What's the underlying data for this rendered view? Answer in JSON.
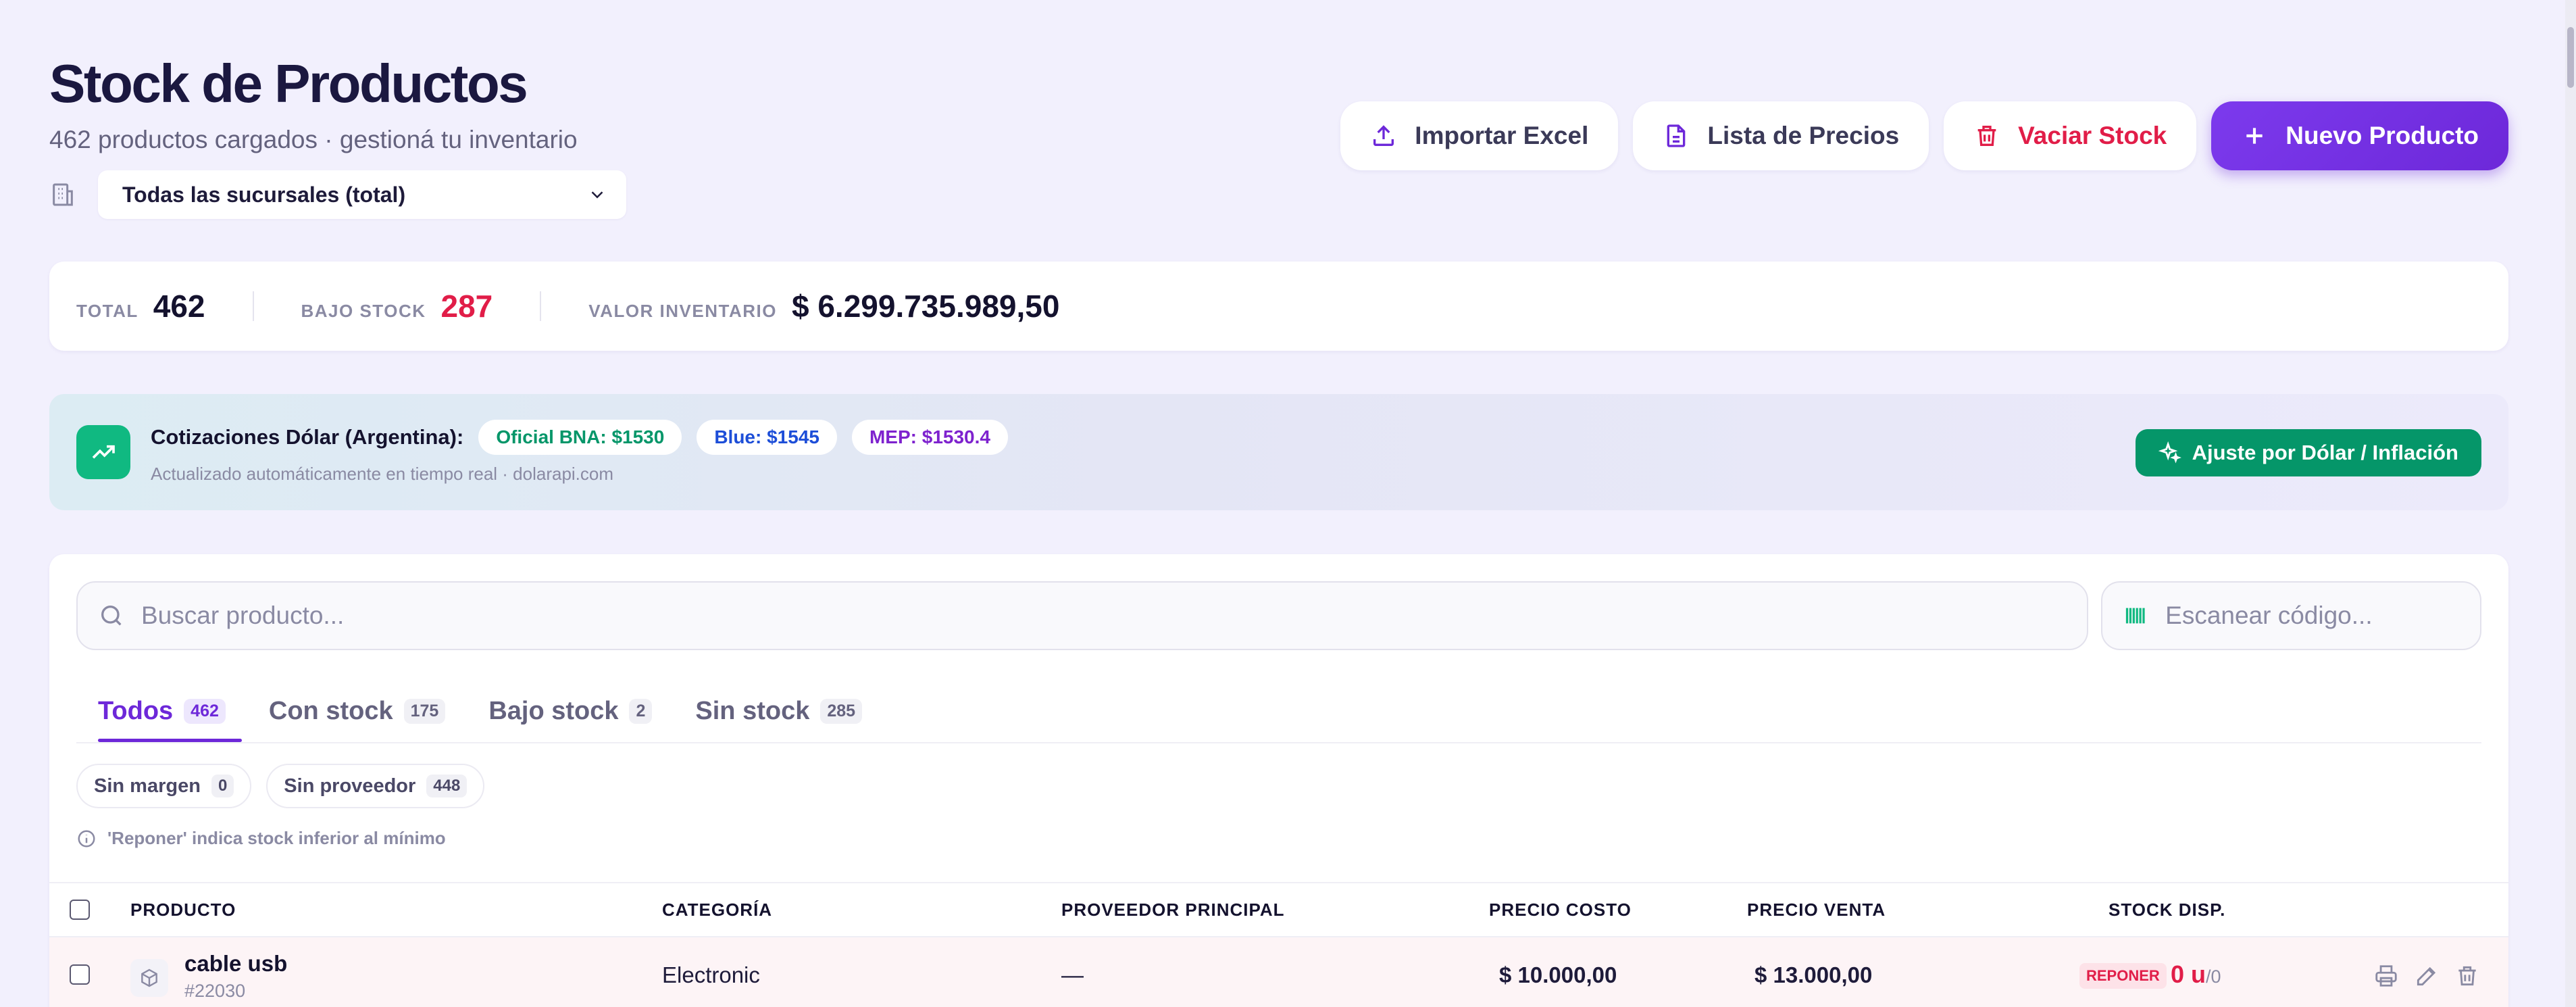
{
  "header": {
    "title": "Stock de Productos",
    "subtitle": "462 productos cargados · gestioná tu inventario",
    "branch_select": "Todas las sucursales (total)"
  },
  "actions": {
    "import": "Importar Excel",
    "price_list": "Lista de Precios",
    "empty_stock": "Vaciar Stock",
    "new_product": "Nuevo Producto"
  },
  "stats": {
    "total_label": "TOTAL",
    "total_value": "462",
    "low_label": "BAJO STOCK",
    "low_value": "287",
    "inv_label": "VALOR INVENTARIO",
    "inv_value": "$ 6.299.735.989,50"
  },
  "dollar": {
    "title": "Cotizaciones Dólar (Argentina):",
    "oficial": "Oficial BNA: $1530",
    "blue": "Blue: $1545",
    "mep": "MEP: $1530.4",
    "subtitle": "Actualizado automáticamente en tiempo real · dolarapi.com",
    "adjust_button": "Ajuste por Dólar / Inflación"
  },
  "search": {
    "placeholder": "Buscar producto...",
    "scan_placeholder": "Escanear código..."
  },
  "tabs": [
    {
      "label": "Todos",
      "count": "462"
    },
    {
      "label": "Con stock",
      "count": "175"
    },
    {
      "label": "Bajo stock",
      "count": "2"
    },
    {
      "label": "Sin stock",
      "count": "285"
    }
  ],
  "chips": [
    {
      "label": "Sin margen",
      "count": "0"
    },
    {
      "label": "Sin proveedor",
      "count": "448"
    }
  ],
  "info_note": "'Reponer' indica stock inferior al mínimo",
  "table": {
    "columns": [
      "PRODUCTO",
      "CATEGORÍA",
      "PROVEEDOR PRINCIPAL",
      "PRECIO COSTO",
      "PRECIO VENTA",
      "STOCK DISP."
    ],
    "rows": [
      {
        "name": "cable usb",
        "code": "#22030",
        "category": "Electronic",
        "supplier": "—",
        "cost": "$ 10.000,00",
        "price": "$ 13.000,00",
        "badge": "REPONER",
        "stock": "0 u",
        "stock_max": "/0"
      }
    ]
  },
  "colors": {
    "accent": "#6d28d9",
    "danger": "#e11d48",
    "success": "#059669",
    "background": "#f2f0fd"
  }
}
